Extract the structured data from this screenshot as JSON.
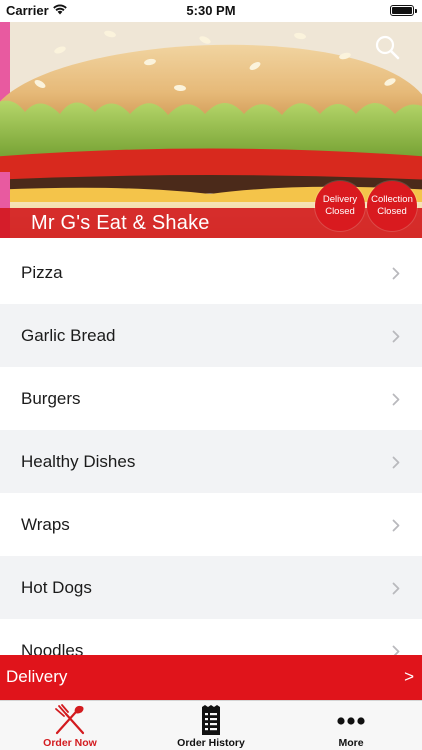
{
  "status_bar": {
    "carrier": "Carrier",
    "time": "5:30 PM",
    "wifi_icon": "wifi-icon",
    "battery_icon": "battery-icon"
  },
  "header": {
    "restaurant_name": "Mr G's Eat & Shake",
    "search_icon": "search-icon",
    "delivery_status": {
      "line1": "Delivery",
      "line2": "Closed"
    },
    "collection_status": {
      "line1": "Collection",
      "line2": "Closed"
    }
  },
  "menu": {
    "items": [
      {
        "label": "Pizza"
      },
      {
        "label": "Garlic Bread"
      },
      {
        "label": "Burgers"
      },
      {
        "label": "Healthy Dishes"
      },
      {
        "label": "Wraps"
      },
      {
        "label": "Hot Dogs"
      },
      {
        "label": "Noodles"
      }
    ],
    "chevron_icon": "chevron-right-icon"
  },
  "delivery_bar": {
    "label": "Delivery",
    "arrow": ">"
  },
  "tab_bar": {
    "tabs": [
      {
        "label": "Order Now",
        "icon": "fork-knife-icon",
        "active": true
      },
      {
        "label": "Order History",
        "icon": "receipt-icon",
        "active": false
      },
      {
        "label": "More",
        "icon": "more-dots-icon",
        "active": false
      }
    ]
  },
  "colors": {
    "accent_red": "#e0141b",
    "status_circle_red": "#d91a1f",
    "alt_row_grey": "#f2f3f5"
  }
}
